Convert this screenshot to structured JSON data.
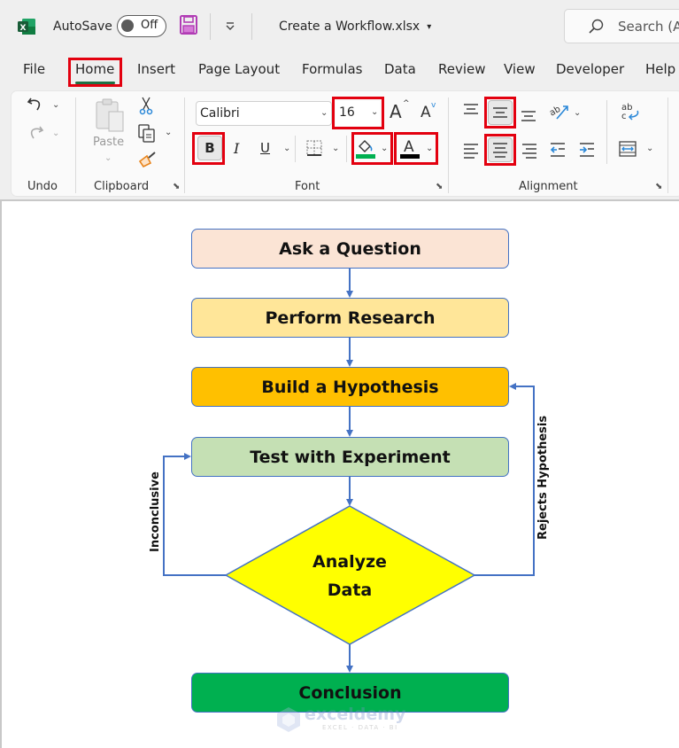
{
  "titlebar": {
    "app_icon": "excel-logo-icon",
    "autosave_label": "AutoSave",
    "autosave_state": "Off",
    "save_icon": "save-icon",
    "quick_access_icon": "customize-quick-access-icon",
    "filename": "Create a Workflow.xlsx",
    "filename_dropdown": "▾",
    "search_placeholder": "Search (A"
  },
  "tabs": [
    {
      "label": "File"
    },
    {
      "label": "Home",
      "active": true,
      "highlighted": true
    },
    {
      "label": "Insert"
    },
    {
      "label": "Page Layout"
    },
    {
      "label": "Formulas"
    },
    {
      "label": "Data"
    },
    {
      "label": "Review"
    },
    {
      "label": "View"
    },
    {
      "label": "Developer"
    },
    {
      "label": "Help"
    }
  ],
  "ribbon": {
    "groups": {
      "undo": {
        "label": "Undo",
        "items": [
          "undo-icon",
          "redo-icon"
        ]
      },
      "clipboard": {
        "label": "Clipboard",
        "paste_label": "Paste",
        "items": [
          "cut-icon",
          "copy-icon",
          "format-painter-icon"
        ]
      },
      "font": {
        "label": "Font",
        "font_name": "Calibri",
        "font_size": "16",
        "increase_font": "A",
        "decrease_font": "A",
        "bold": "B",
        "italic": "I",
        "underline": "U",
        "font_color_letter": "A",
        "fill_color": "#00b050",
        "font_color": "#000000",
        "highlighted": [
          "font-size",
          "bold",
          "fill-color",
          "font-color"
        ]
      },
      "alignment": {
        "label": "Alignment",
        "highlighted": [
          "middle-align",
          "center-align"
        ],
        "wrap_text": "ab c"
      }
    }
  },
  "flowchart": {
    "steps": [
      {
        "label": "Ask a Question",
        "fill": "#fbe4d5"
      },
      {
        "label": "Perform Research",
        "fill": "#ffe699"
      },
      {
        "label": "Build a Hypothesis",
        "fill": "#ffc000"
      },
      {
        "label": "Test with Experiment",
        "fill": "#c5e0b4"
      }
    ],
    "decision": {
      "line1": "Analyze",
      "line2": "Data",
      "fill": "#ffff00"
    },
    "end": {
      "label": "Conclusion",
      "fill": "#00b050"
    },
    "loop_left_label": "Inconclusive",
    "loop_right_label": "Rejects  Hypothesis",
    "connector_color": "#4472c4"
  },
  "watermark": {
    "name": "exceldemy",
    "tagline": "EXCEL · DATA · BI"
  }
}
